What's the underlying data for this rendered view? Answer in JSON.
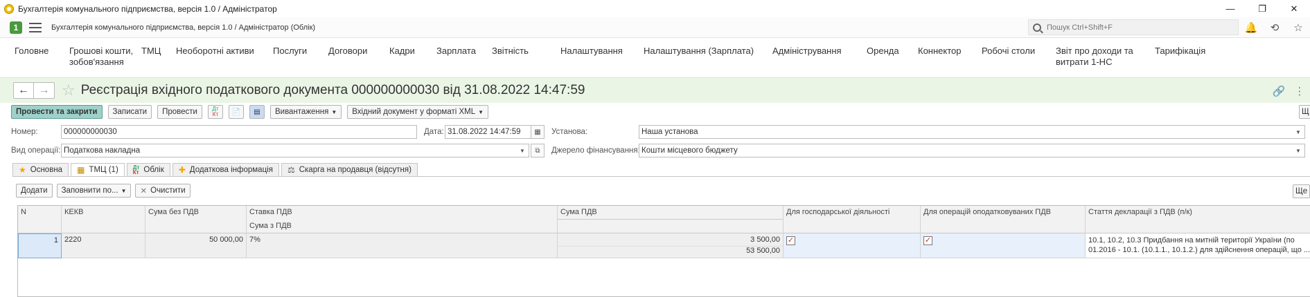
{
  "window": {
    "title": "Бухгалтерія комунального підприємства, версія 1.0 / Адміністратор",
    "controls": [
      "—",
      "❐",
      "✕"
    ]
  },
  "app": {
    "title": "Бухгалтерія комунального підприємства, версія 1.0 / Адміністратор  (Облік)",
    "search_placeholder": "Пошук Ctrl+Shift+F"
  },
  "menu": [
    {
      "label": "Головне"
    },
    {
      "label": "Грошові кошти,\nзобов'язання"
    },
    {
      "label": "ТМЦ"
    },
    {
      "label": "Необоротні активи"
    },
    {
      "label": "Послуги"
    },
    {
      "label": "Договори"
    },
    {
      "label": "Кадри"
    },
    {
      "label": "Зарплата"
    },
    {
      "label": "Звітність"
    },
    {
      "label": "Налаштування"
    },
    {
      "label": "Налаштування (Зарплата)"
    },
    {
      "label": "Адміністрування"
    },
    {
      "label": "Оренда"
    },
    {
      "label": "Коннектор"
    },
    {
      "label": "Робочі столи"
    },
    {
      "label": "Звіт про доходи та\nвитрати 1-НС"
    },
    {
      "label": "Тарифікація"
    }
  ],
  "form": {
    "title": "Реєстрація вхідного податкового документа 000000000030 від 31.08.2022 14:47:59"
  },
  "toolbar": {
    "post_close": "Провести та закрити",
    "save": "Записати",
    "post": "Провести",
    "dt_kt_top": "Дт",
    "dt_kt_bottom": "Кт",
    "unload": "Вивантаження",
    "xml": "Вхідний документ у форматі XML",
    "more": "Щ"
  },
  "fields": {
    "number_label": "Номер:",
    "number_value": "000000000030",
    "date_label": "Дата:",
    "date_value": "31.08.2022 14:47:59",
    "org_label": "Установа:",
    "org_value": "Наша установа",
    "optype_label": "Вид операції:",
    "optype_value": "Податкова накладна",
    "finsource_label": "Джерело фінансування:",
    "finsource_value": "Кошти місцевого бюджету"
  },
  "tabs": [
    {
      "label": "Основна",
      "icon": "star-icon"
    },
    {
      "label": "ТМЦ (1)",
      "icon": "table-icon"
    },
    {
      "label": "Облік",
      "icon": "dt-kt-icon"
    },
    {
      "label": "Додаткова інформація",
      "icon": "star-plus-icon"
    },
    {
      "label": "Скарга на продавця (відсутня)",
      "icon": "scale-icon"
    }
  ],
  "table_toolbar": {
    "add": "Додати",
    "fill": "Заповнити по...",
    "clear": "Очистити",
    "more": "Ще"
  },
  "grid": {
    "headers": {
      "n": "N",
      "kekv": "КЕКВ",
      "sum_no_vat": "Сума без ПДВ",
      "vat_rate": "Ставка ПДВ",
      "sum_with_vat": "Сума з ПДВ",
      "vat_sum": "Сума ПДВ",
      "business": "Для господарської діяльності",
      "vat_ops": "Для операцій оподатковуваних ПДВ",
      "decl_article": "Стаття декларації з ПДВ (п/к)"
    },
    "rows": [
      {
        "n": "1",
        "kekv": "2220",
        "sum_no_vat": "50 000,00",
        "vat_rate": "7%",
        "vat_sum": "3 500,00",
        "sum_with_vat": "53 500,00",
        "business": true,
        "vat_ops": true,
        "decl_article_1": "10.1, 10.2, 10.3 Придбання на митній території України (по",
        "decl_article_2": "01.2016 - 10.1. (10.1.1., 10.1.2.) для здійснення операцій, що ..."
      }
    ]
  },
  "colors": {
    "form_header_bg": "#ebf5e6",
    "primary_button": "#9fd1cb",
    "selected_cell": "#dce9f8",
    "check_mark": "#c0392b"
  }
}
